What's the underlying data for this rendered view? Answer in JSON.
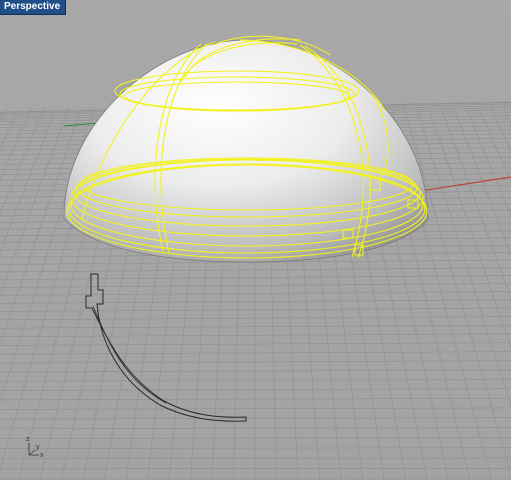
{
  "viewport": {
    "tab_label": "Perspective",
    "background_color": "#a6a6a6",
    "grid_color": "#8f8f8f",
    "x_axis_color": "#c0392b",
    "y_axis_color": "#2e8b3a",
    "selection_color": "#f2f220",
    "curve_color": "#2a2a2a"
  },
  "world_axes_icon": {
    "x_label": "x",
    "y_label": "y",
    "z_label": "z"
  }
}
